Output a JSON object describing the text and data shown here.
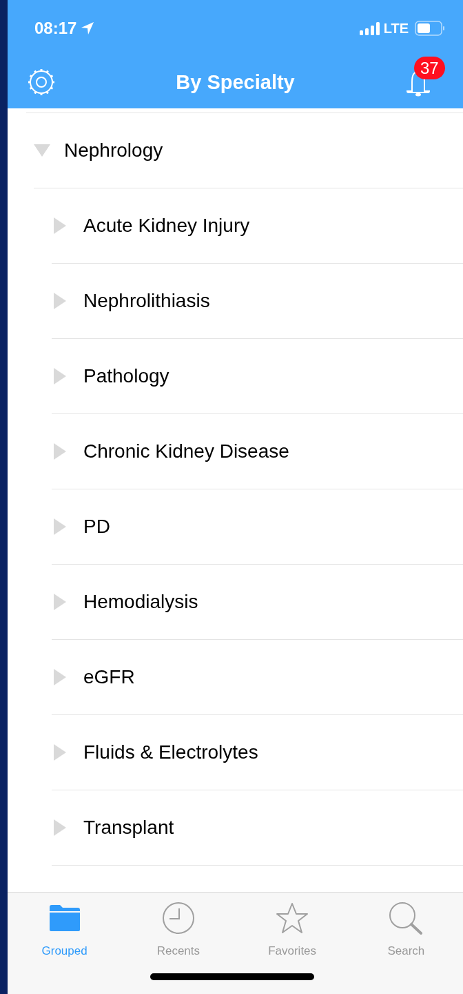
{
  "status_bar": {
    "time": "08:17",
    "network": "LTE"
  },
  "nav_bar": {
    "title": "By Specialty",
    "badge": "37"
  },
  "tree": [
    {
      "label": "Nephrology",
      "expanded": true,
      "children": [
        {
          "label": "Acute Kidney Injury",
          "expanded": false
        },
        {
          "label": "Nephrolithiasis",
          "expanded": false
        },
        {
          "label": "Pathology",
          "expanded": false
        },
        {
          "label": "Chronic Kidney Disease",
          "expanded": false
        },
        {
          "label": "PD",
          "expanded": false
        },
        {
          "label": "Hemodialysis",
          "expanded": false
        },
        {
          "label": "eGFR",
          "expanded": false
        },
        {
          "label": "Fluids & Electrolytes",
          "expanded": false
        },
        {
          "label": "Transplant",
          "expanded": false
        }
      ]
    }
  ],
  "tab_bar": [
    {
      "label": "Grouped",
      "kind": "folder",
      "selected": true
    },
    {
      "label": "Recents",
      "kind": "clock",
      "selected": false
    },
    {
      "label": "Favorites",
      "kind": "star",
      "selected": false
    },
    {
      "label": "Search",
      "kind": "search",
      "selected": false
    }
  ]
}
